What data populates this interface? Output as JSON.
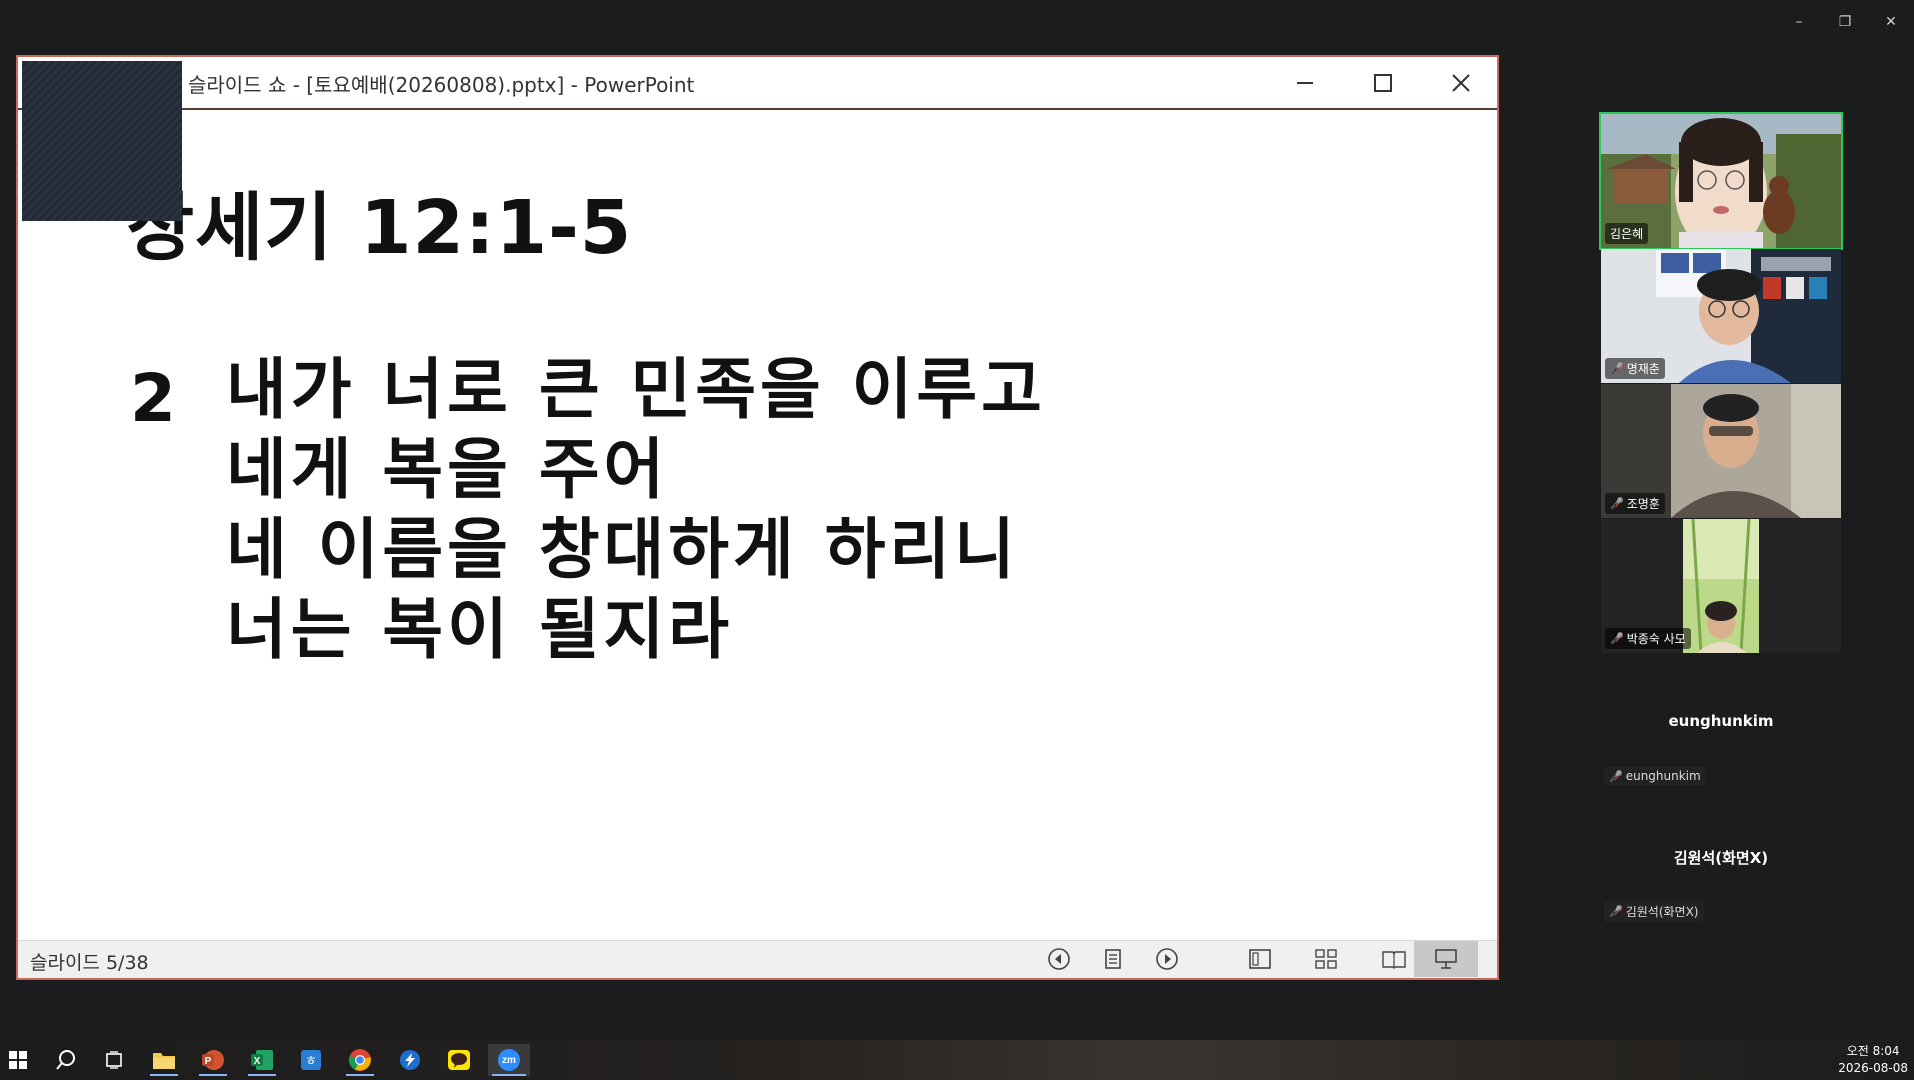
{
  "window_controls": {
    "minimize": "–",
    "restore": "❐",
    "close": "✕"
  },
  "powerpoint": {
    "title": "슬라이드 쇼 - [토요예배(20260808).pptx] - PowerPoint",
    "slide": {
      "heading": "창세기 12:1-5",
      "verse_number": "2",
      "verse_lines": [
        "내가 너로 큰 민족을 이루고",
        "네게 복을 주어",
        "네 이름을 창대하게 하리니",
        "너는 복이 될지라"
      ]
    },
    "status": {
      "counter": "슬라이드 5/38"
    }
  },
  "participants": [
    {
      "name": "김은혜",
      "muted": false,
      "speaking": true
    },
    {
      "name": "명재춘",
      "muted": true
    },
    {
      "name": "조명훈",
      "muted": true
    },
    {
      "name": "박종숙 사모",
      "muted": true
    },
    {
      "name": "eunghunkim",
      "display": "eunghunkim",
      "muted": true
    },
    {
      "name": "김원석(화면X)",
      "display": "김원석(화면X)",
      "muted": true
    }
  ],
  "taskbar": {
    "apps": [
      "start-icon",
      "search-icon",
      "task-view-icon",
      "file-explorer-icon",
      "powerpoint-icon",
      "excel-icon",
      "hangul-icon",
      "chrome-icon",
      "remote-icon",
      "kakaotalk-icon",
      "zoom-icon"
    ],
    "zoom_label": "zm",
    "clock": {
      "time": "오전 8:04",
      "date": "2026-08-08"
    }
  }
}
